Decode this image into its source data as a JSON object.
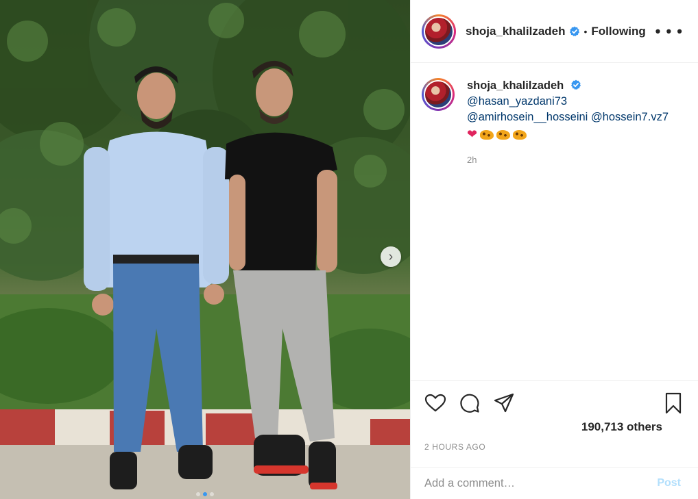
{
  "post": {
    "username": "shoja_khalilzadeh",
    "separator": "•",
    "follow_status": "Following",
    "more_icon": "• • •",
    "caption": {
      "username": "shoja_khalilzadeh",
      "mentions": [
        "@hasan_yazdani73",
        "@amirhosein__hosseini",
        "@hossein7.vz7"
      ],
      "emoji_heart": "❤",
      "emoji_animals": [
        "leopard",
        "leopard",
        "leopard"
      ],
      "time_ago": "2h"
    },
    "likes_text": "190,713 others",
    "timestamp": "2 HOURS AGO",
    "comment_placeholder": "Add a comment…",
    "post_label": "Post",
    "carousel_next_icon": "›",
    "carousel_dots": 3,
    "carousel_active_index": 1
  },
  "colors": {
    "link": "#00376b",
    "verified": "#3897f0",
    "post_disabled": "#b2dffc",
    "muted": "#8e8e8e"
  },
  "icons": [
    "heart-icon",
    "comment-icon",
    "share-icon",
    "bookmark-icon",
    "verified-badge-icon",
    "more-options-icon",
    "chevron-right-icon"
  ]
}
